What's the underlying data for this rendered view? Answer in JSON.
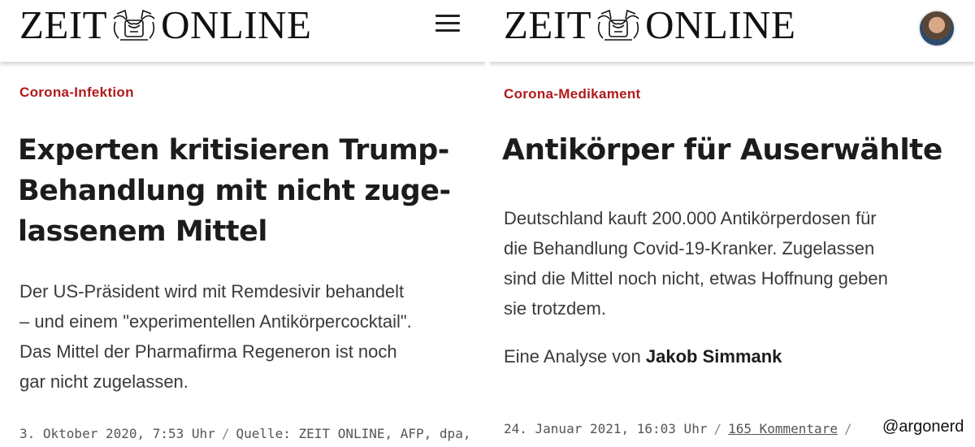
{
  "left_article": {
    "logo_left": "ZEIT",
    "logo_right": "ONLINE",
    "menu_icon": "hamburger-menu-icon",
    "kicker": "Corona-Infektion",
    "headline_lines": [
      "Experten kritisieren Trump-",
      "Behandlung mit nicht zuge-",
      "lassenem Mittel"
    ],
    "summary_lines": [
      "Der US-Präsident wird mit Remdesivir behandelt",
      "– und einem \"experimentellen Antikörpercocktail\".",
      "Das Mittel der Pharmafirma Regeneron ist noch",
      "gar nicht zugelassen."
    ],
    "date": "3. Oktober 2020, 7:53 Uhr",
    "separator": "/",
    "source": "Quelle: ZEIT ONLINE, AFP, dpa,"
  },
  "right_article": {
    "logo_left": "ZEIT",
    "logo_right": "ONLINE",
    "avatar_icon": "user-avatar-icon",
    "kicker": "Corona-Medikament",
    "headline": "Antikörper für Auserwählte",
    "summary_lines": [
      "Deutschland kauft 200.000 Antikörperdosen für",
      "die Behandlung Covid-19-Kranker. Zugelassen",
      "sind die Mittel noch nicht, etwas Hoffnung geben",
      "sie trotzdem."
    ],
    "byline_prefix": "Eine Analyse von",
    "author": "Jakob Simmank",
    "date": "24. Januar 2021, 16:03 Uhr",
    "separator": "/",
    "comments": "165 Kommentare",
    "separator2": "/"
  },
  "watermark": "@argonerd",
  "colors": {
    "kicker": "#b0191b",
    "text": "#252525"
  }
}
